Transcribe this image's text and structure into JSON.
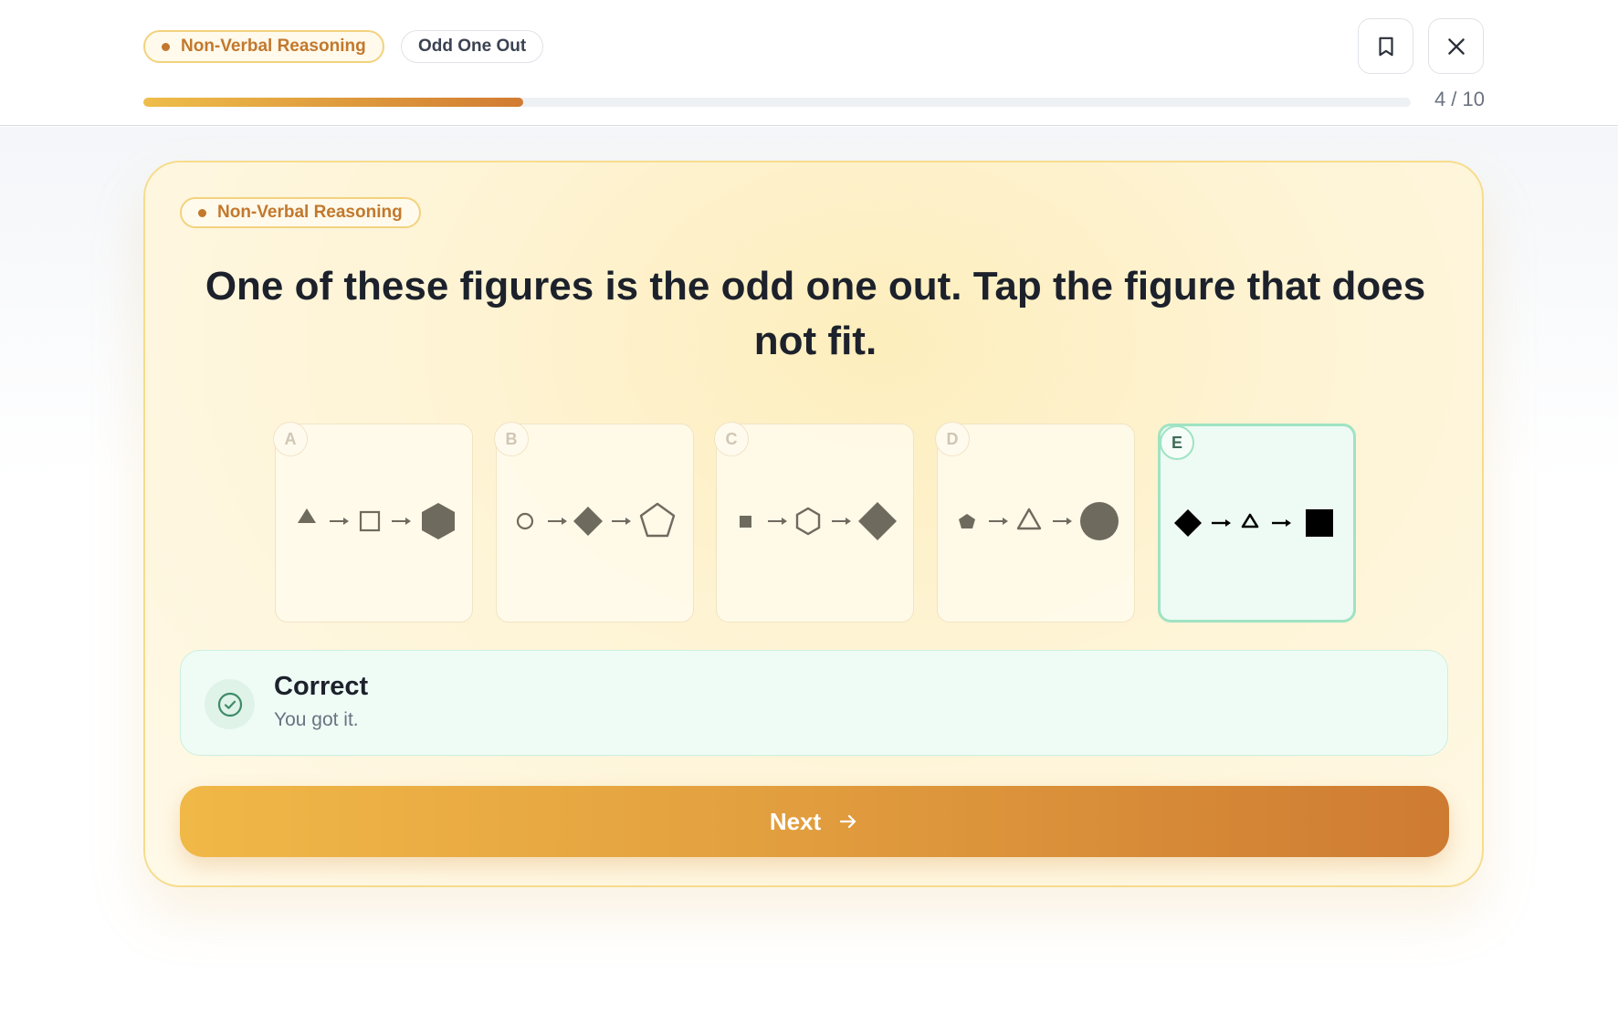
{
  "header": {
    "subject_chip": "Non-Verbal Reasoning",
    "topic_chip": "Odd One Out",
    "progress": {
      "current": 4,
      "total": 10,
      "label": "4 / 10",
      "fraction": 0.3
    }
  },
  "question": {
    "subject_chip": "Non-Verbal Reasoning",
    "text": "One of these figures is the odd one out. Tap the figure that does not fit.",
    "options": [
      {
        "letter": "A",
        "sequence": [
          "small-triangle",
          "arrow",
          "square-outline",
          "arrow",
          "large-hexagon-filled"
        ]
      },
      {
        "letter": "B",
        "sequence": [
          "small-circle-outline",
          "arrow",
          "diamond-filled",
          "arrow",
          "large-pentagon-outline"
        ]
      },
      {
        "letter": "C",
        "sequence": [
          "small-square-filled",
          "arrow",
          "hexagon-outline",
          "arrow",
          "large-diamond-filled"
        ]
      },
      {
        "letter": "D",
        "sequence": [
          "small-pentagon-filled",
          "arrow",
          "triangle-outline",
          "arrow",
          "large-circle-filled"
        ]
      },
      {
        "letter": "E",
        "sequence": [
          "diamond-filled",
          "arrow",
          "small-triangle-outline",
          "arrow",
          "large-square-filled"
        ]
      }
    ],
    "selected": "E"
  },
  "feedback": {
    "title": "Correct",
    "subtitle": "You got it.",
    "icon": "check-circle-icon"
  },
  "next_button": {
    "label": "Next"
  },
  "colors": {
    "accent": "#c2782d",
    "correct": "#9fe3c2",
    "figure": "#6f6a5e"
  }
}
